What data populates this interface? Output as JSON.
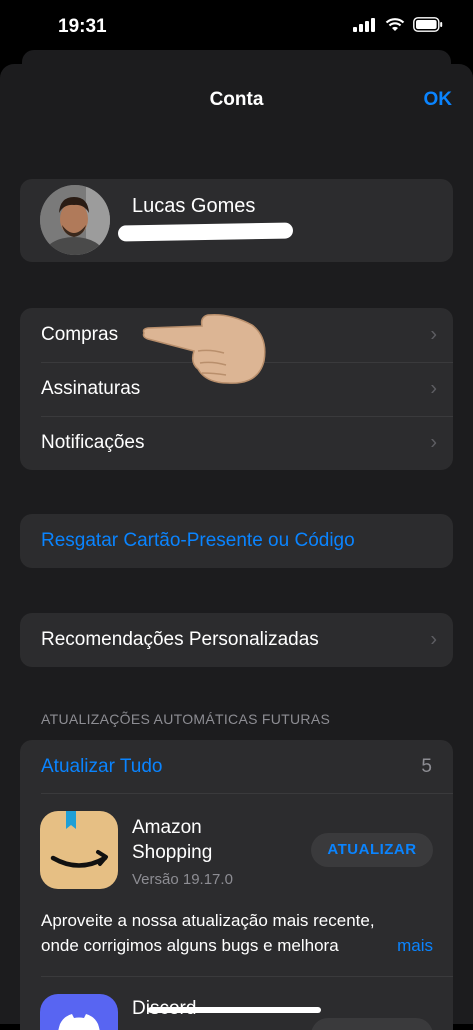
{
  "status": {
    "time": "19:31"
  },
  "nav": {
    "title": "Conta",
    "ok": "OK"
  },
  "profile": {
    "name": "Lucas Gomes"
  },
  "menu": [
    {
      "label": "Compras"
    },
    {
      "label": "Assinaturas"
    },
    {
      "label": "Notificações"
    }
  ],
  "redeem": {
    "label": "Resgatar Cartão-Presente ou Código"
  },
  "recommendations": {
    "label": "Recomendações Personalizadas"
  },
  "updates": {
    "header": "ATUALIZAÇÕES AUTOMÁTICAS FUTURAS",
    "update_all": "Atualizar Tudo",
    "count": "5",
    "apps": [
      {
        "name_line1": "Amazon",
        "name_line2": "Shopping",
        "version": "Versão 19.17.0",
        "button": "ATUALIZAR",
        "notes_line1": "Aproveite a nossa atualização mais recente,",
        "notes_line2": "onde corrigimos alguns bugs e melhora",
        "more": "mais"
      },
      {
        "name_line1": "Discord"
      }
    ]
  },
  "colors": {
    "accent": "#0a84ff",
    "background": "#1c1c1e",
    "card": "#2c2c2e"
  }
}
